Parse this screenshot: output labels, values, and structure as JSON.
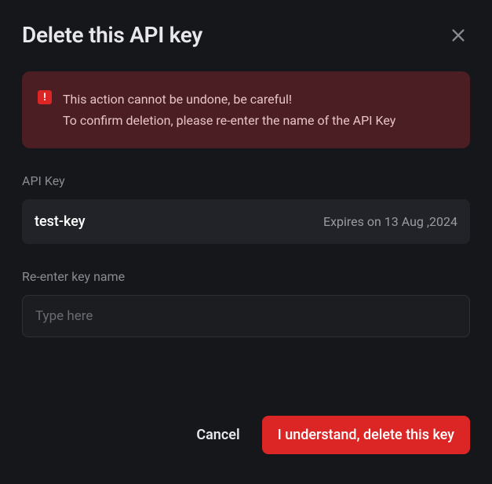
{
  "modal": {
    "title": "Delete this API key",
    "warning": {
      "line1": "This action cannot be undone, be careful!",
      "line2": "To confirm deletion, please re-enter the name of the API Key"
    },
    "api_key": {
      "label": "API Key",
      "name": "test-key",
      "expiry": "Expires on 13 Aug ,2024"
    },
    "reenter": {
      "label": "Re-enter key name",
      "placeholder": "Type here",
      "value": ""
    },
    "actions": {
      "cancel": "Cancel",
      "delete": "I understand, delete this key"
    }
  }
}
